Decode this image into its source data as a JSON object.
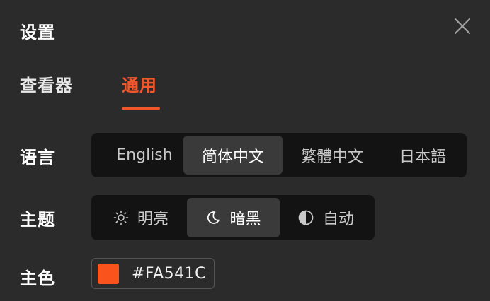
{
  "dialog": {
    "title": "设置"
  },
  "tabs": [
    {
      "label": "查看器",
      "active": false
    },
    {
      "label": "通用",
      "active": true
    }
  ],
  "language": {
    "label": "语言",
    "options": [
      "English",
      "简体中文",
      "繁體中文",
      "日本語"
    ],
    "selected": "简体中文"
  },
  "theme": {
    "label": "主题",
    "options": [
      {
        "label": "明亮",
        "icon": "sun-icon"
      },
      {
        "label": "暗黑",
        "icon": "moon-icon"
      },
      {
        "label": "自动",
        "icon": "half-circle-icon"
      }
    ],
    "selected": "暗黑"
  },
  "primary_color": {
    "label": "主色",
    "value": "#FA541C"
  },
  "colors": {
    "accent": "#f0572a",
    "background": "#2b2b2c",
    "segment_bg": "#131314",
    "segment_active": "#3a3a3b"
  }
}
